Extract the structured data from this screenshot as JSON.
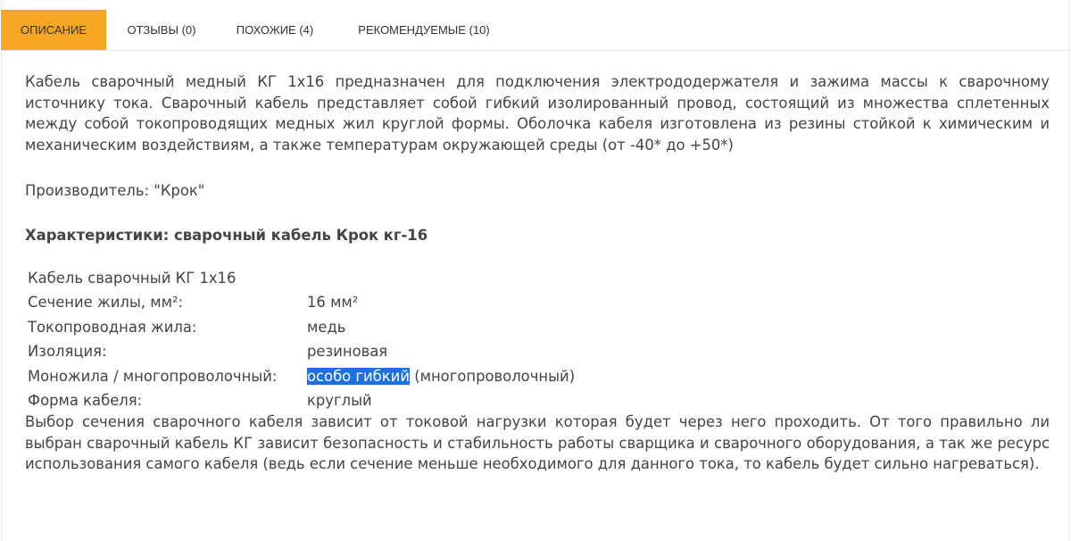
{
  "tabs": [
    {
      "label": "ОПИСАНИЕ",
      "active": true
    },
    {
      "label": "ОТЗЫВЫ (0)",
      "active": false
    },
    {
      "label": "ПОХОЖИЕ (4)",
      "active": false
    },
    {
      "label": "РЕКОМЕНДУЕМЫЕ (10)",
      "active": false
    }
  ],
  "description": {
    "intro": "Кабель сварочный медный КГ 1х16 предназначен для подключения электрододержателя и зажима массы к сварочному источнику тока. Сварочный кабель представляет собой гибкий изолированный провод, состоящий из множества сплетенных между собой токопроводящих медных жил круглой формы. Оболочка кабеля изготовлена из резины стойкой к химическим и механическим воздействиям, а также температурам окружающей среды (от -40* до +50*)",
    "manufacturer": "Производитель: \"Крок\"",
    "heading": "Характеристики: сварочный кабель Крок кг-16",
    "specs_title": "Кабель сварочный КГ 1х16",
    "specs": [
      {
        "key": "Сечение жилы, мм²:",
        "value": "16 мм²"
      },
      {
        "key": "Токопроводная жила:",
        "value": "медь"
      },
      {
        "key": "Изоляция:",
        "value": "резиновая"
      },
      {
        "key": "Моножила / многопроволочный:",
        "value_highlight": "особо гибкий",
        "value_rest": " (многопроволочный)"
      },
      {
        "key": "Форма кабеля:",
        "value": "круглый"
      }
    ],
    "footer": "Выбор сечения сварочного кабеля зависит от токовой нагрузки которая будет через него проходить. От того правильно ли выбран сварочный кабель КГ зависит безопасность и стабильность работы сварщика и сварочного оборудования, а так же ресурс использования самого кабеля (ведь если сечение меньше необходимого для данного тока, то кабель будет сильно нагреваться)."
  },
  "colors": {
    "active_tab": "#f5a623",
    "selection": "#1e6fe0",
    "text": "#444444"
  }
}
